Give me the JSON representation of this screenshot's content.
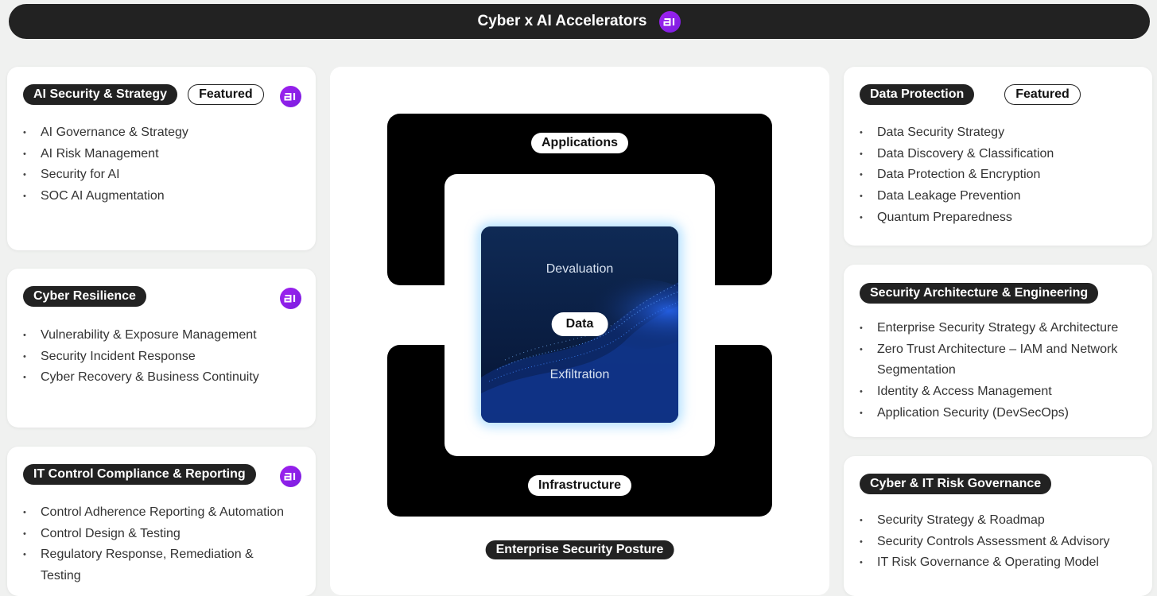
{
  "header": {
    "title": "Cyber x AI Accelerators"
  },
  "left_cards": [
    {
      "title": "AI Security & Strategy",
      "tag": "Featured",
      "items": [
        "AI Governance & Strategy",
        "AI Risk Management",
        "Security for AI",
        "SOC AI Augmentation"
      ]
    },
    {
      "title": "Cyber Resilience",
      "items": [
        "Vulnerability & Exposure Management",
        "Security Incident Response",
        "Cyber Recovery & Business Continuity"
      ]
    },
    {
      "title": "IT Control Compliance & Reporting",
      "items": [
        "Control Adherence Reporting & Automation",
        "Control Design & Testing",
        "Regulatory Response, Remediation & Testing"
      ]
    }
  ],
  "right_cards": [
    {
      "title": "Data Protection",
      "tag": "Featured",
      "items": [
        "Data Security Strategy",
        "Data Discovery & Classification",
        "Data Protection & Encryption",
        "Data Leakage Prevention",
        "Quantum Preparedness"
      ]
    },
    {
      "title": "Security Architecture & Engineering",
      "items": [
        "Enterprise Security Strategy & Architecture",
        "Zero Trust Architecture – IAM and Network Segmentation",
        "Identity & Access Management",
        "Application Security (DevSecOps)"
      ]
    },
    {
      "title": "Cyber & IT Risk Governance",
      "items": [
        "Security Strategy & Roadmap",
        "Security Controls Assessment & Advisory",
        "IT Risk Governance & Operating Model"
      ]
    }
  ],
  "diagram": {
    "top_label": "Applications",
    "bottom_label": "Infrastructure",
    "core_label": "Data",
    "upper_text": "Devaluation",
    "lower_text": "Exfiltration",
    "footer_label": "Enterprise Security Posture"
  },
  "colors": {
    "dark": "#222222",
    "ai_badge": "#8a1ee8",
    "background": "#f0f1f0"
  },
  "icons": {
    "ai_badge": "ai-logo-icon"
  }
}
